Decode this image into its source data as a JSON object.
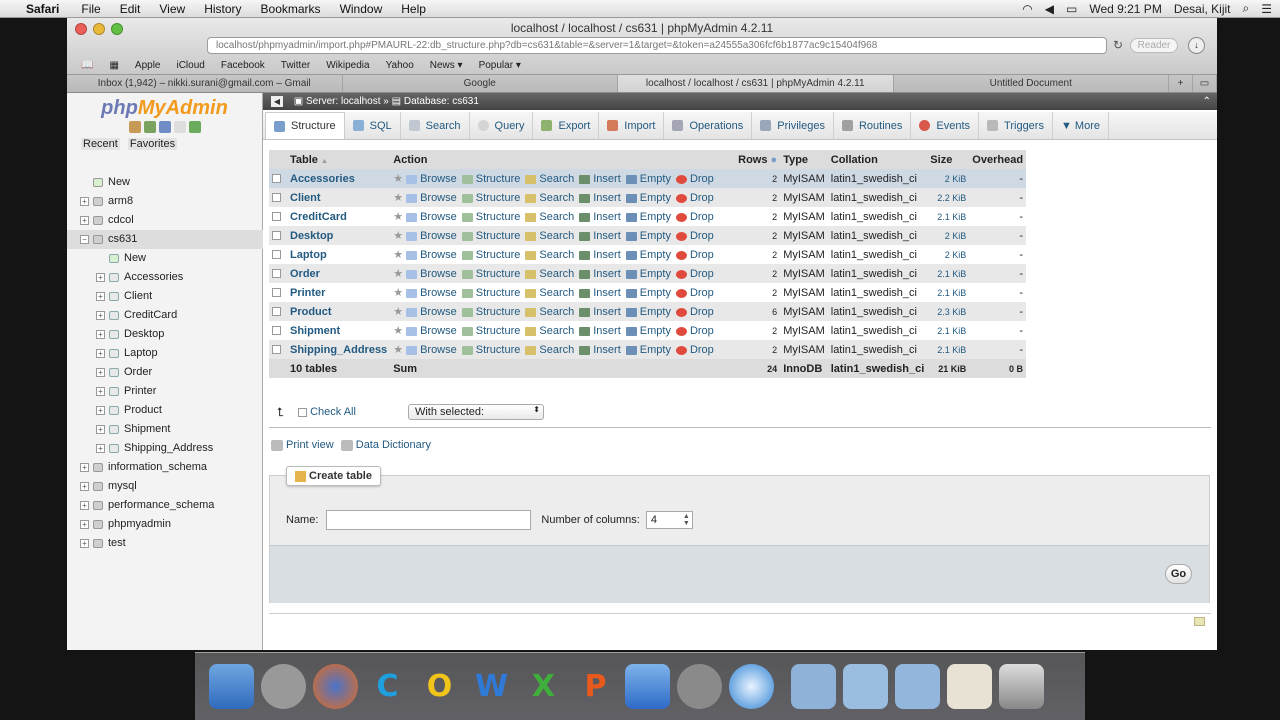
{
  "menubar": {
    "app": "Safari",
    "items": [
      "File",
      "Edit",
      "View",
      "History",
      "Bookmarks",
      "Window",
      "Help"
    ],
    "clock": "Wed 9:21 PM",
    "user": "Desai, Kijit"
  },
  "browser": {
    "window_title": "localhost / localhost / cs631 | phpMyAdmin 4.2.11",
    "url": "localhost/phpmyadmin/import.php#PMAURL-22:db_structure.php?db=cs631&table=&server=1&target=&token=a24555a306fcf6b1877ac9c15404f968",
    "reader": "Reader",
    "bookmarks": [
      "Apple",
      "iCloud",
      "Facebook",
      "Twitter",
      "Wikipedia",
      "Yahoo",
      "News ▾",
      "Popular ▾"
    ],
    "tabs": [
      "Inbox (1,942) – nikki.surani@gmail.com – Gmail",
      "Google",
      "localhost / localhost / cs631 | phpMyAdmin 4.2.11",
      "Untitled Document"
    ]
  },
  "sidebar": {
    "logo_a": "php",
    "logo_b": "MyAdmin",
    "recent": "Recent",
    "favorites": "Favorites",
    "top_new": "New",
    "databases": [
      {
        "name": "arm8"
      },
      {
        "name": "cdcol"
      },
      {
        "name": "cs631",
        "children": [
          "New",
          "Accessories",
          "Client",
          "CreditCard",
          "Desktop",
          "Laptop",
          "Order",
          "Printer",
          "Product",
          "Shipment",
          "Shipping_Address"
        ]
      },
      {
        "name": "information_schema"
      },
      {
        "name": "mysql"
      },
      {
        "name": "performance_schema"
      },
      {
        "name": "phpmyadmin"
      },
      {
        "name": "test"
      }
    ]
  },
  "breadcrumb": {
    "server": "Server: localhost",
    "database": "Database: cs631"
  },
  "tabs": [
    "Structure",
    "SQL",
    "Search",
    "Query",
    "Export",
    "Import",
    "Operations",
    "Privileges",
    "Routines",
    "Events",
    "Triggers",
    "More"
  ],
  "table": {
    "headers": {
      "table": "Table",
      "action": "Action",
      "rows": "Rows",
      "type": "Type",
      "collation": "Collation",
      "size": "Size",
      "overhead": "Overhead"
    },
    "actions": [
      "Browse",
      "Structure",
      "Search",
      "Insert",
      "Empty",
      "Drop"
    ],
    "rows": [
      {
        "name": "Accessories",
        "rows": "2",
        "type": "MyISAM",
        "collation": "latin1_swedish_ci",
        "size": "2 KiB",
        "overhead": "-"
      },
      {
        "name": "Client",
        "rows": "2",
        "type": "MyISAM",
        "collation": "latin1_swedish_ci",
        "size": "2.2 KiB",
        "overhead": "-"
      },
      {
        "name": "CreditCard",
        "rows": "2",
        "type": "MyISAM",
        "collation": "latin1_swedish_ci",
        "size": "2.1 KiB",
        "overhead": "-"
      },
      {
        "name": "Desktop",
        "rows": "2",
        "type": "MyISAM",
        "collation": "latin1_swedish_ci",
        "size": "2 KiB",
        "overhead": "-"
      },
      {
        "name": "Laptop",
        "rows": "2",
        "type": "MyISAM",
        "collation": "latin1_swedish_ci",
        "size": "2 KiB",
        "overhead": "-"
      },
      {
        "name": "Order",
        "rows": "2",
        "type": "MyISAM",
        "collation": "latin1_swedish_ci",
        "size": "2.1 KiB",
        "overhead": "-"
      },
      {
        "name": "Printer",
        "rows": "2",
        "type": "MyISAM",
        "collation": "latin1_swedish_ci",
        "size": "2.1 KiB",
        "overhead": "-"
      },
      {
        "name": "Product",
        "rows": "6",
        "type": "MyISAM",
        "collation": "latin1_swedish_ci",
        "size": "2.3 KiB",
        "overhead": "-"
      },
      {
        "name": "Shipment",
        "rows": "2",
        "type": "MyISAM",
        "collation": "latin1_swedish_ci",
        "size": "2.1 KiB",
        "overhead": "-"
      },
      {
        "name": "Shipping_Address",
        "rows": "2",
        "type": "MyISAM",
        "collation": "latin1_swedish_ci",
        "size": "2.1 KiB",
        "overhead": "-"
      }
    ],
    "sum": {
      "label": "10 tables",
      "action": "Sum",
      "rows": "24",
      "type": "InnoDB",
      "collation": "latin1_swedish_ci",
      "size": "21 KiB",
      "overhead": "0 B"
    }
  },
  "bulk": {
    "check_all": "Check All",
    "with_selected": "With selected:"
  },
  "links": {
    "print_view": "Print view",
    "data_dictionary": "Data Dictionary"
  },
  "create_table": {
    "legend": "Create table",
    "name_label": "Name:",
    "name_value": "",
    "columns_label": "Number of columns:",
    "columns_value": "4",
    "go": "Go"
  }
}
